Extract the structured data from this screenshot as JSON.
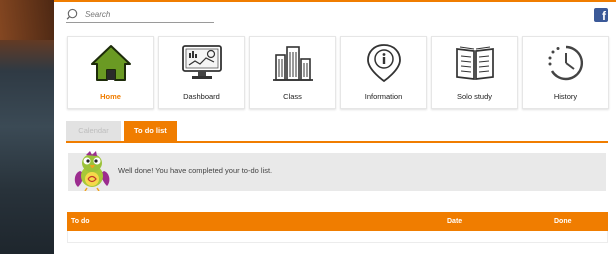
{
  "search": {
    "placeholder": "Search"
  },
  "social": {
    "facebook_label": "f"
  },
  "tiles": [
    {
      "label": "Home",
      "icon": "home-icon",
      "active": true
    },
    {
      "label": "Dashboard",
      "icon": "dashboard-monitor-icon",
      "active": false
    },
    {
      "label": "Class",
      "icon": "class-buildings-icon",
      "active": false
    },
    {
      "label": "Information",
      "icon": "information-pin-icon",
      "active": false
    },
    {
      "label": "Solo study",
      "icon": "open-book-icon",
      "active": false
    },
    {
      "label": "History",
      "icon": "history-clock-icon",
      "active": false
    }
  ],
  "tabs": [
    {
      "label": "Calendar",
      "active": false
    },
    {
      "label": "To do list",
      "active": true
    }
  ],
  "message": {
    "text": "Well done! You have completed your to-do list."
  },
  "table": {
    "headers": [
      "To do",
      "Date",
      "Done"
    ]
  },
  "colors": {
    "accent": "#f07d00",
    "home_green": "#5e8c1f",
    "facebook": "#3b5998"
  }
}
